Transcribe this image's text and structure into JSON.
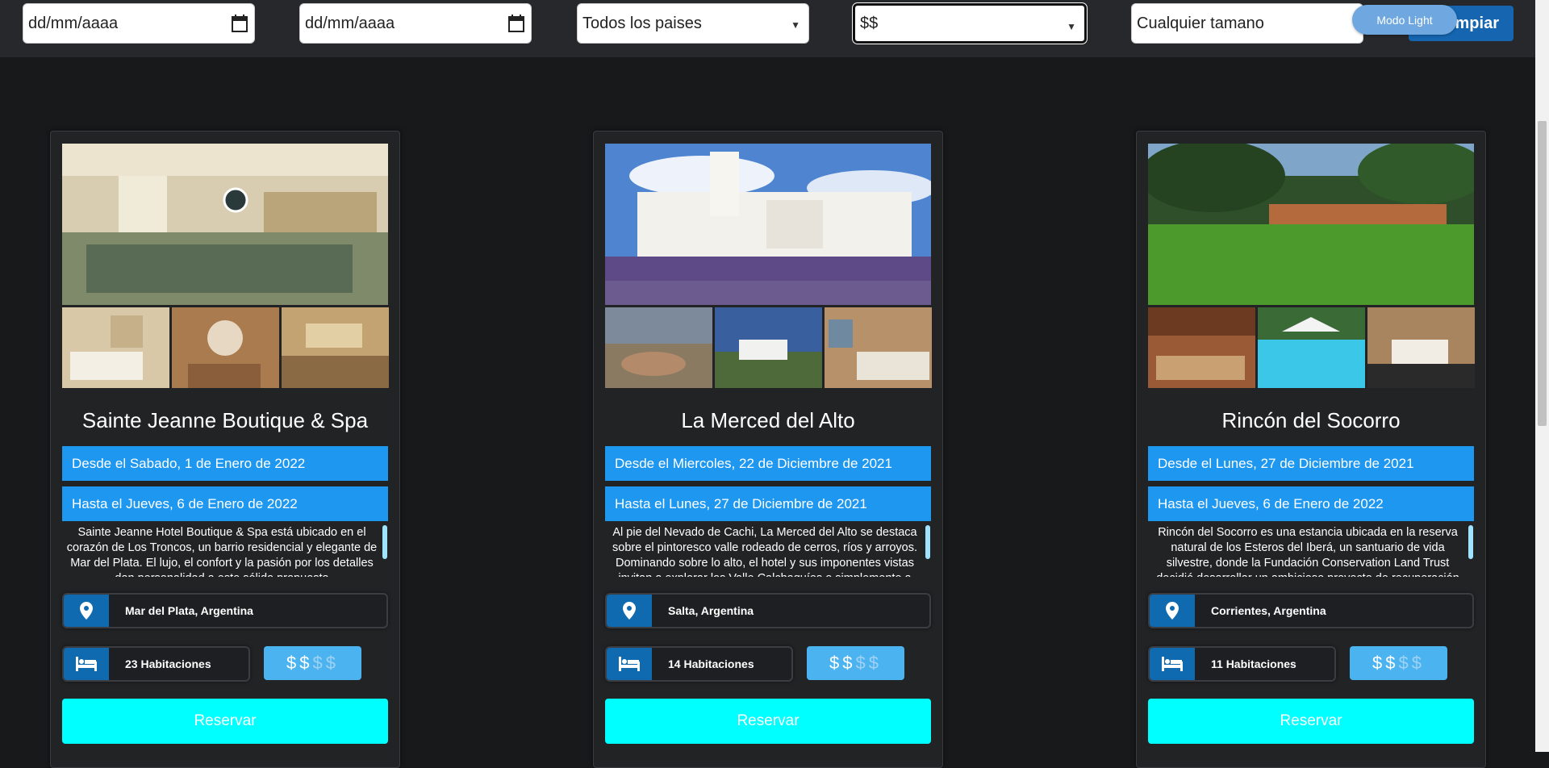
{
  "filters": {
    "date_from_placeholder": "dd/mm/aaaa",
    "date_to_placeholder": "dd/mm/aaaa",
    "country_select": "Todos los paises",
    "price_select": "$$",
    "size_select": "Cualquier tamano",
    "clear_label": "Limpiar",
    "clear_visible": "impiar",
    "theme_toggle_label": "Modo Light"
  },
  "hotels": [
    {
      "name": "Sainte Jeanne Boutique & Spa",
      "date_from": "Desde el Sabado, 1 de Enero de 2022",
      "date_to": "Hasta el Jueves, 6 de Enero de 2022",
      "description": "Sainte Jeanne Hotel Boutique & Spa está ubicado en el corazón de Los Troncos, un barrio residencial y elegante de Mar del Plata. El lujo, el confort y la pasión por los detalles dan personalidad a este sólido propuesta",
      "location": "Mar del Plata, Argentina",
      "rooms": "23 Habitaciones",
      "price_level": 2,
      "reserve_label": "Reservar"
    },
    {
      "name": "La Merced del Alto",
      "date_from": "Desde el Miercoles, 22 de Diciembre de 2021",
      "date_to": "Hasta el Lunes, 27 de Diciembre de 2021",
      "description": "Al pie del Nevado de Cachi, La Merced del Alto se destaca sobre el pintoresco valle rodeado de cerros, ríos y arroyos. Dominando sobre lo alto, el hotel y sus imponentes vistas invitan a explorar los Valle Calchaquíes o simplemente a",
      "location": "Salta, Argentina",
      "rooms": "14 Habitaciones",
      "price_level": 2,
      "reserve_label": "Reservar"
    },
    {
      "name": "Rincón del Socorro",
      "date_from": "Desde el Lunes, 27 de Diciembre de 2021",
      "date_to": "Hasta el Jueves, 6 de Enero de 2022",
      "description": "Rincón del Socorro es una estancia ubicada en la reserva natural de los Esteros del Iberá, un santuario de vida silvestre, donde la Fundación Conservation Land Trust decidió desarrollar un ambicioso proyecto de recuperación",
      "location": "Corrientes, Argentina",
      "rooms": "11 Habitaciones",
      "price_level": 2,
      "reserve_label": "Reservar"
    }
  ],
  "price_symbols": [
    "$",
    "$",
    "$",
    "$"
  ],
  "colors": {
    "date_bar": "#1e97f0",
    "icon_box": "#0f6ab0",
    "reserve": "#00ffff",
    "price_box": "#4ab3f0"
  }
}
